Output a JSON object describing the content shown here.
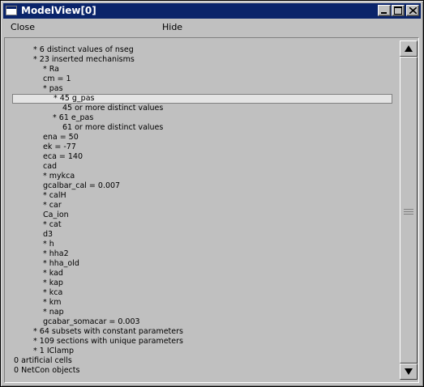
{
  "window": {
    "title": "ModelView[0]"
  },
  "menu": {
    "close_label": "Close",
    "hide_label": "Hide"
  },
  "tree": {
    "rows": [
      "* 6 distinct values of nseg",
      "* 23 inserted mechanisms",
      "* Ra",
      "cm = 1",
      "* pas",
      "* 45 g_pas",
      "45 or more distinct values",
      "* 61 e_pas",
      "61 or more distinct values",
      "ena = 50",
      "ek = -77",
      "eca = 140",
      "cad",
      "* mykca",
      "gcalbar_cal = 0.007",
      "* calH",
      "* car",
      "Ca_ion",
      "* cat",
      "d3",
      "* h",
      "* hha2",
      "* hha_old",
      "* kad",
      "* kap",
      "* kca",
      "* km",
      "* nap",
      "gcabar_somacar = 0.003",
      "* 64 subsets with constant parameters",
      "* 109 sections with unique parameters",
      "* 1 IClamp",
      "0 artificial cells",
      "0 NetCon objects"
    ],
    "selected_row": "* 45 g_pas"
  },
  "icons": {
    "window_icon": "window-icon",
    "minimize": "minimize-icon",
    "maximize": "maximize-icon",
    "close": "close-icon",
    "scroll_up": "arrow-up-icon",
    "scroll_down": "arrow-down-icon"
  },
  "colors": {
    "titlebar": "#0a246a",
    "background": "#c0c0c0",
    "selection": "#e4e4e4"
  }
}
